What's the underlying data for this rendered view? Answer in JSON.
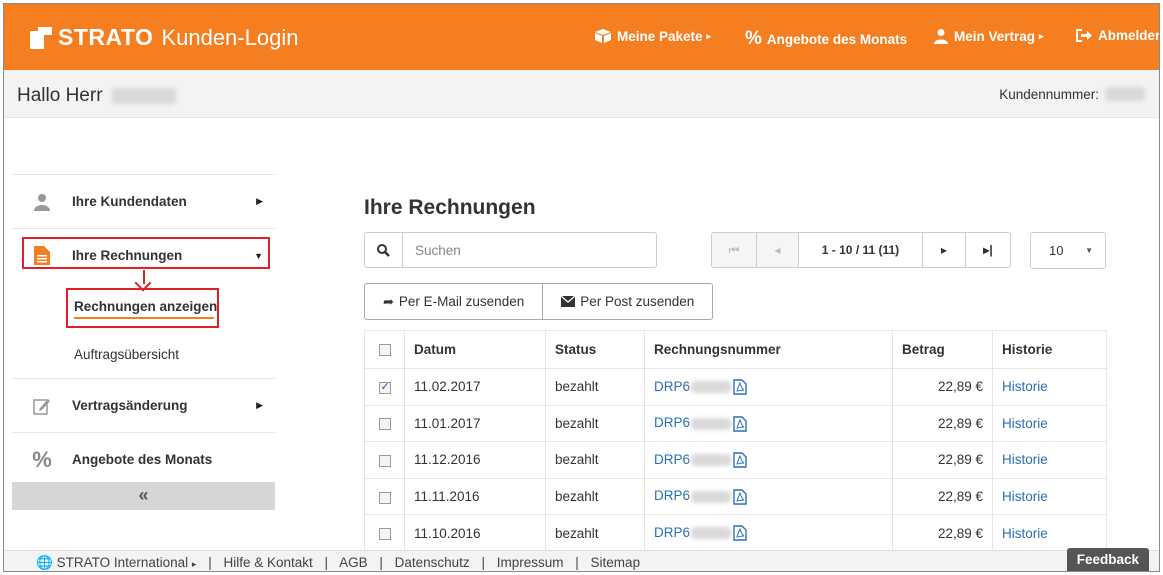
{
  "header": {
    "brand": "STRATO",
    "subtitle": "Kunden-Login",
    "nav": [
      {
        "label": "Meine Pakete",
        "icon": "box-icon"
      },
      {
        "label": "Angebote des Monats",
        "icon": "percent-icon"
      },
      {
        "label": "Mein Vertrag",
        "icon": "user-icon"
      },
      {
        "label": "Abmelden",
        "icon": "logout-icon"
      }
    ]
  },
  "greeting": {
    "hello": "Hallo Herr",
    "customer_number_label": "Kundennummer:"
  },
  "sidebar": {
    "items": [
      {
        "label": "Ihre Kundendaten",
        "icon": "user-icon"
      },
      {
        "label": "Ihre Rechnungen",
        "icon": "document-icon"
      },
      {
        "label": "Vertragsänderung",
        "icon": "edit-icon"
      },
      {
        "label": "Angebote des Monats",
        "icon": "percent-icon"
      }
    ],
    "subitems": [
      {
        "label": "Rechnungen anzeigen"
      },
      {
        "label": "Auftragsübersicht"
      }
    ],
    "collapse_label": "«"
  },
  "main": {
    "title": "Ihre Rechnungen",
    "search_placeholder": "Suchen",
    "pager_info": "1 - 10 / 11 (11)",
    "per_page": "10",
    "actions": {
      "email": "Per E-Mail zusenden",
      "post": "Per Post zusenden"
    },
    "table": {
      "headers": [
        "Datum",
        "Status",
        "Rechnungsnummer",
        "Betrag",
        "Historie"
      ],
      "rows": [
        {
          "checked": true,
          "date": "11.02.2017",
          "status": "bezahlt",
          "invoice_prefix": "DRP6",
          "amount": "22,89 €",
          "history": "Historie"
        },
        {
          "checked": false,
          "date": "11.01.2017",
          "status": "bezahlt",
          "invoice_prefix": "DRP6",
          "amount": "22,89 €",
          "history": "Historie"
        },
        {
          "checked": false,
          "date": "11.12.2016",
          "status": "bezahlt",
          "invoice_prefix": "DRP6",
          "amount": "22,89 €",
          "history": "Historie"
        },
        {
          "checked": false,
          "date": "11.11.2016",
          "status": "bezahlt",
          "invoice_prefix": "DRP6",
          "amount": "22,89 €",
          "history": "Historie"
        },
        {
          "checked": false,
          "date": "11.10.2016",
          "status": "bezahlt",
          "invoice_prefix": "DRP6",
          "amount": "22,89 €",
          "history": "Historie"
        }
      ]
    }
  },
  "footer": {
    "links": [
      "STRATO International",
      "Hilfe & Kontakt",
      "AGB",
      "Datenschutz",
      "Impressum",
      "Sitemap"
    ],
    "feedback": "Feedback"
  },
  "colors": {
    "brand_orange": "#f47e20",
    "highlight_red": "#e01f26",
    "link_blue": "#2a6ebb"
  }
}
